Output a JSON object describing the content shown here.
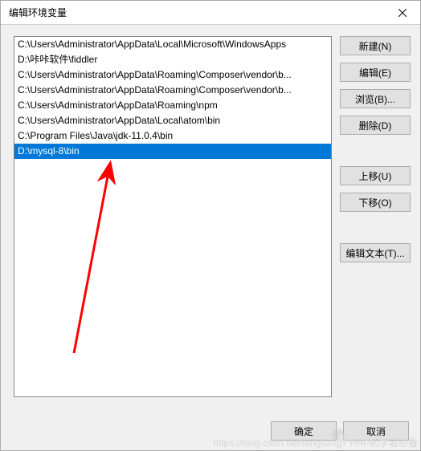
{
  "window": {
    "title": "编辑环境变量"
  },
  "list": {
    "items": [
      "C:\\Users\\Administrator\\AppData\\Local\\Microsoft\\WindowsApps",
      "D:\\咔咔软件\\fiddler",
      "C:\\Users\\Administrator\\AppData\\Roaming\\Composer\\vendor\\b...",
      "C:\\Users\\Administrator\\AppData\\Roaming\\Composer\\vendor\\b...",
      "C:\\Users\\Administrator\\AppData\\Roaming\\npm",
      "C:\\Users\\Administrator\\AppData\\Local\\atom\\bin",
      "C:\\Program Files\\Java\\jdk-11.0.4\\bin",
      "D:\\mysql-8\\bin"
    ],
    "selected_index": 7
  },
  "buttons": {
    "new": "新建(N)",
    "edit": "编辑(E)",
    "browse": "浏览(B)...",
    "delete": "删除(D)",
    "move_up": "上移(U)",
    "move_down": "下移(O)",
    "edit_text": "编辑文本(T)...",
    "ok": "确定",
    "cancel": "取消"
  },
  "watermark": "https://blog.csdn.net/fangkang7  PHP初学者必看"
}
